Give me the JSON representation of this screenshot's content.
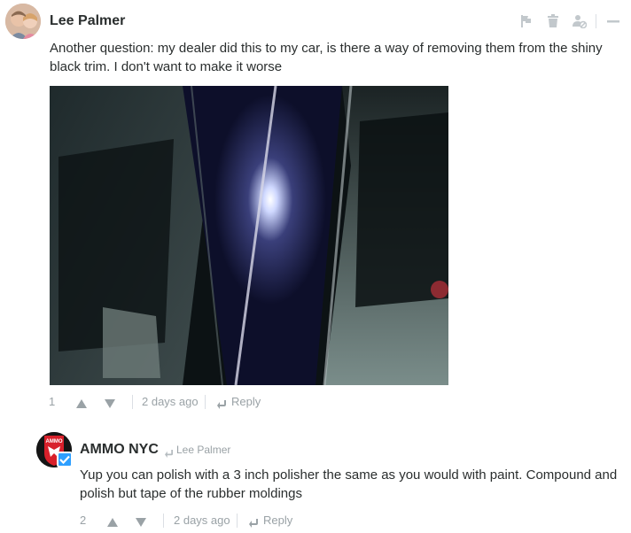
{
  "comments": [
    {
      "author": "Lee Palmer",
      "text": "Another question: my dealer did this to my car, is there a way of removing them from the shiny black trim. I don't want to make it worse",
      "votes": "1",
      "time": "2 days ago",
      "reply_label": "Reply"
    },
    {
      "author": "AMMO NYC",
      "in_reply_to": "Lee Palmer",
      "avatar_text": "AMMO",
      "text": "Yup you can polish with a 3 inch polisher the same as you would with paint. Compound and polish but tape of the rubber moldings",
      "votes": "2",
      "time": "2 days ago",
      "reply_label": "Reply"
    }
  ],
  "toolbar_icons": [
    "flag-icon",
    "trash-icon",
    "block-user-icon",
    "collapse-icon"
  ],
  "colors": {
    "muted": "#9aa2a6",
    "text": "#2a2e2e",
    "verified": "#2e9fff",
    "brand_red": "#d8202b"
  }
}
